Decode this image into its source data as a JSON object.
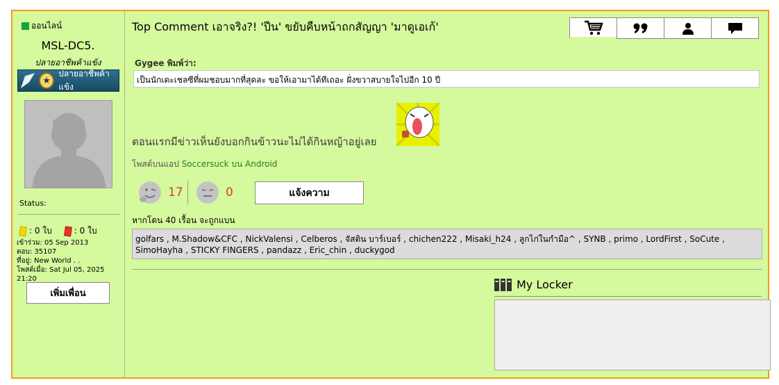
{
  "user": {
    "online_label": "ออนไลน์",
    "username": "MSL-DC5.",
    "title": "ปลายอาชีพค้าแข้ง",
    "rank_badge": "ปลายอาชีพค้าแข้ง",
    "status_label": "Status:",
    "yellow_cards": ": 0 ใบ",
    "red_cards": ": 0 ใบ",
    "joined": "เข้าร่วม: 05 Sep 2013",
    "answers": "ตอบ: 35107",
    "location": "ที่อยู่: New World . .",
    "posted_at": "โพสต์เมื่อ: Sat Jul 05, 2025 21:20",
    "add_friend_label": "เพิ่มเพื่อน"
  },
  "post": {
    "title": "Top Comment เอาจริง?! 'ปีน' ขยับคืบหน้าถกสัญญา 'มาดูเอเก้'",
    "quote_by": "Gygee พิมพ์ว่า:",
    "quote_text": "เป็นนักเตะเชลซีที่ผมชอบมากที่สุดละ ขอให้เอามาได้ทีเถอะ ฝั่งขวาสบายใจไปอีก 10 ปี",
    "comment": "ตอนแรกมีข่าวเห็นยังบอกกินข้าวนะไม่ได้กินหญ้าอยู่เลย",
    "app_prefix": "โพสต์บนแอป",
    "app_name": "Soccersuck บน Android",
    "likes": "17",
    "dislikes": "0",
    "report_label": "แจ้งความ",
    "ban_note": "หากโดน 40 เรื้อน จะถูกแบน",
    "voters": "golfars , M.Shadow&CFC , NickValensi , Celberos , จัสติน บาร์เบอร์ , chichen222 , Misaki_h24 , ลูกไก่ในกำมือ^ , SYNB , primo , LordFirst , SoCute , SimoHayha , STICKY FINGERS , pandazz , Eric_chin , duckygod"
  },
  "toolbar": {
    "icons": [
      "cart-icon",
      "quote-icon",
      "user-icon",
      "comment-icon"
    ]
  },
  "locker": {
    "title": "My Locker"
  },
  "colors": {
    "page_bg": "#d5f99d",
    "border_accent": "#f39c12",
    "online": "#1aa33a",
    "like_count": "#e03a2a",
    "app_link": "#2c7a1e"
  }
}
